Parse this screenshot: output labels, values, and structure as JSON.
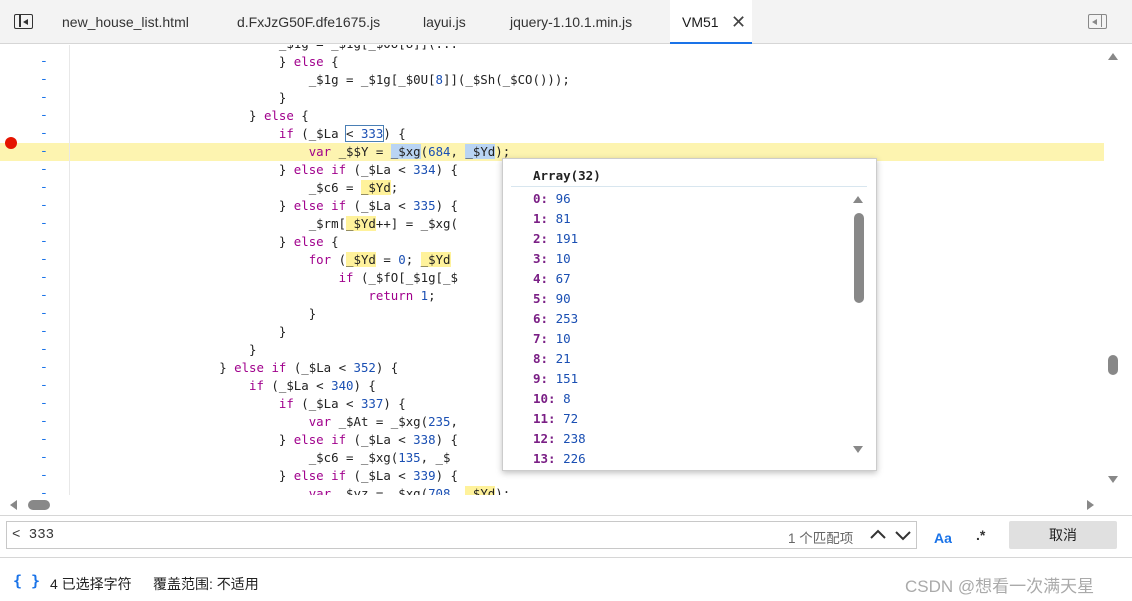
{
  "tabs": [
    {
      "label": "new_house_list.html"
    },
    {
      "label": "d.FxJzG50F.dfe1675.js"
    },
    {
      "label": "layui.js"
    },
    {
      "label": "jquery-1.10.1.min.js"
    },
    {
      "label": "VM51",
      "active": true
    }
  ],
  "code_lines": [
    {
      "dash": "-",
      "text": "                            } else {"
    },
    {
      "dash": "-",
      "text": "                                _$1g = _$1g[_$0U[8]](_$Sh(_$CO()));"
    },
    {
      "dash": "-",
      "text": "                            }"
    },
    {
      "dash": "-",
      "text": "                        } else {"
    },
    {
      "dash": "-",
      "text": "                            if (_$La < 333) {"
    },
    {
      "dash": "-",
      "text": "                                var _$$Y = _$xg(684, _$Yd);"
    },
    {
      "dash": "-",
      "text": "                            } else if (_$La < 334) {"
    },
    {
      "dash": "-",
      "text": "                                _$c6 = _$Yd;"
    },
    {
      "dash": "-",
      "text": "                            } else if (_$La < 335) {"
    },
    {
      "dash": "-",
      "text": "                                _$rm[_$Yd++] = _$xg("
    },
    {
      "dash": "-",
      "text": "                            } else {"
    },
    {
      "dash": "-",
      "text": "                                for (_$Yd = 0; _$Yd"
    },
    {
      "dash": "-",
      "text": "                                    if (_$fO[_$1g[_$"
    },
    {
      "dash": "-",
      "text": "                                        return 1;"
    },
    {
      "dash": "-",
      "text": "                                }"
    },
    {
      "dash": "-",
      "text": "                            }"
    },
    {
      "dash": "-",
      "text": "                        }"
    },
    {
      "dash": "-",
      "text": "                    } else if (_$La < 352) {"
    },
    {
      "dash": "-",
      "text": "                        if (_$La < 340) {"
    },
    {
      "dash": "-",
      "text": "                            if (_$La < 337) {"
    },
    {
      "dash": "-",
      "text": "                                var _$At = _$xg(235,"
    },
    {
      "dash": "-",
      "text": "                            } else if (_$La < 338) {"
    },
    {
      "dash": "-",
      "text": "                                _$c6 = _$xg(135, _$"
    },
    {
      "dash": "-",
      "text": "                            } else if (_$La < 339) {"
    },
    {
      "dash": "-",
      "text": "                                var _$yz = _$xg(708, _$Yd);"
    }
  ],
  "popup": {
    "title": "Array(32)",
    "items": [
      {
        "idx": "0",
        "val": "96"
      },
      {
        "idx": "1",
        "val": "81"
      },
      {
        "idx": "2",
        "val": "191"
      },
      {
        "idx": "3",
        "val": "10"
      },
      {
        "idx": "4",
        "val": "67"
      },
      {
        "idx": "5",
        "val": "90"
      },
      {
        "idx": "6",
        "val": "253"
      },
      {
        "idx": "7",
        "val": "10"
      },
      {
        "idx": "8",
        "val": "21"
      },
      {
        "idx": "9",
        "val": "151"
      },
      {
        "idx": "10",
        "val": "8"
      },
      {
        "idx": "11",
        "val": "72"
      },
      {
        "idx": "12",
        "val": "238"
      },
      {
        "idx": "13",
        "val": "226"
      }
    ]
  },
  "search": {
    "value": "< 333",
    "match_count": "1 个匹配项",
    "case_label": "Aa",
    "regex_label": ".*",
    "cancel_label": "取消"
  },
  "status": {
    "braces": "{ }",
    "selected": "4 已选择字符",
    "coverage": "覆盖范围: 不适用"
  },
  "watermark": "CSDN @想看一次满天星"
}
